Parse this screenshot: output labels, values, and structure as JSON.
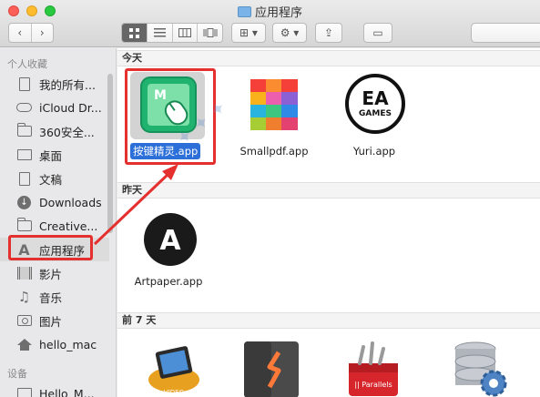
{
  "window": {
    "title": "应用程序"
  },
  "toolbar": {
    "back_glyph": "‹",
    "forward_glyph": "›",
    "views": [
      "icon-view",
      "list-view",
      "column-view",
      "cover-flow-view"
    ],
    "arrange_glyph": "⊞ ▾",
    "action_glyph": "⚙ ▾",
    "share_glyph": "⇪",
    "tag_glyph": "▭"
  },
  "sidebar": {
    "favorites_heading": "个人收藏",
    "devices_heading": "设备",
    "items": [
      {
        "label": "我的所有...",
        "icon": "all-files-icon"
      },
      {
        "label": "iCloud Dr...",
        "icon": "cloud-icon"
      },
      {
        "label": "360安全...",
        "icon": "folder-icon"
      },
      {
        "label": "桌面",
        "icon": "desktop-icon"
      },
      {
        "label": "文稿",
        "icon": "document-icon"
      },
      {
        "label": "Downloads",
        "icon": "download-icon"
      },
      {
        "label": "Creative...",
        "icon": "folder-icon"
      },
      {
        "label": "应用程序",
        "icon": "applications-icon"
      },
      {
        "label": "影片",
        "icon": "film-icon"
      },
      {
        "label": "音乐",
        "icon": "music-icon"
      },
      {
        "label": "图片",
        "icon": "camera-icon"
      },
      {
        "label": "hello_mac",
        "icon": "home-icon"
      }
    ],
    "device_items": [
      {
        "label": "Hello_M...",
        "icon": "laptop-icon"
      }
    ]
  },
  "content": {
    "sections": [
      {
        "label": "今天"
      },
      {
        "label": "昨天"
      },
      {
        "label": "前 7 天"
      }
    ],
    "apps_today": [
      {
        "name": "按键精灵.app",
        "icon": "anjian-app-icon"
      },
      {
        "name": "Smallpdf.app",
        "icon": "smallpdf-app-icon"
      },
      {
        "name": "Yuri.app",
        "icon": "ea-games-icon"
      }
    ],
    "apps_yesterday": [
      {
        "name": "Artpaper.app",
        "icon": "artpaper-app-icon"
      }
    ],
    "apps_week": [
      {
        "name": "",
        "icon": "video-app-icon"
      },
      {
        "name": "",
        "icon": "sublime-app-icon"
      },
      {
        "name": "",
        "icon": "parallels-app-icon"
      },
      {
        "name": "",
        "icon": "database-app-icon"
      }
    ],
    "ea_logo_text": "EA",
    "ea_logo_sub": "GAMES",
    "artpaper_letter": "A",
    "anjian_letter": "M",
    "parallels_text": "|| Parallels",
    "video_text": "VIDEO"
  },
  "colors": {
    "selection": "#2d6fd9",
    "highlight_red": "#e53030",
    "anjian_green": "#1fb36f"
  }
}
